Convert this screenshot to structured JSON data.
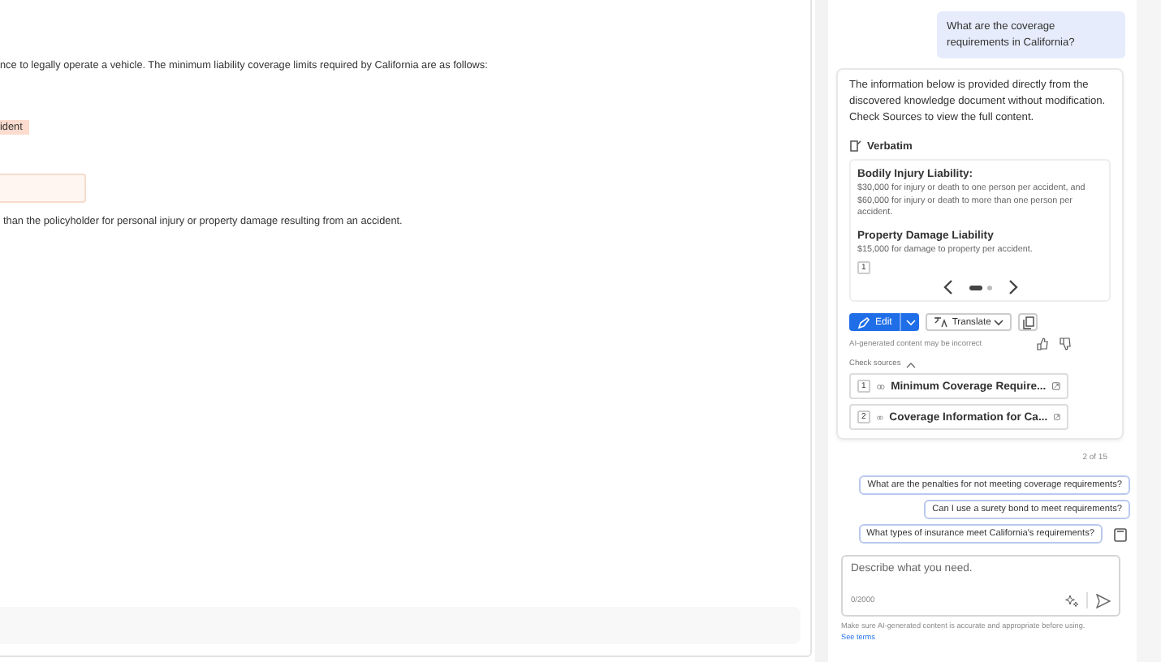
{
  "document": {
    "paragraph_1": "nce to legally operate a vehicle. The minimum liability coverage limits required by California are as follows:",
    "highlight": "ident",
    "paragraph_2": "than the policyholder for personal injury or property damage resulting from an accident."
  },
  "chat": {
    "user_message": "What are the coverage requirements in California?",
    "answer": {
      "intro": "The information below is provided directly from the discovered knowledge document without modification. Check Sources to view the full content.",
      "verbatim_label": "Verbatim",
      "sections": [
        {
          "heading": "Bodily Injury Liability:",
          "text": "$30,000 for injury or death to one person per accident, and $60,000 for injury or death to more than one person per accident."
        },
        {
          "heading": "Property Damage Liability",
          "text": "$15,000 for damage to property per accident."
        }
      ],
      "citation": "1",
      "pages": [
        {
          "selected": true
        },
        {
          "selected": false
        }
      ],
      "edit_label": "Edit",
      "translate_label": "Translate",
      "disclaimer": "AI-generated content may be incorrect",
      "sources_label": "Check sources",
      "sources_expanded": true,
      "sources": [
        {
          "number": "1",
          "title": "Minimum Coverage Require..."
        },
        {
          "number": "2",
          "title": "Coverage Information for Ca..."
        }
      ]
    },
    "counter": "2 of 15",
    "suggestions": [
      "What are the penalties for not meeting coverage requirements?",
      "Can I use a surety bond to meet requirements?",
      "What types of insurance meet California's requirements?"
    ],
    "input": {
      "placeholder": "Describe what you need.",
      "count": "0/2000"
    },
    "footer": "Make sure AI-generated content is accurate and appropriate before using.",
    "footer_link": "See terms"
  }
}
